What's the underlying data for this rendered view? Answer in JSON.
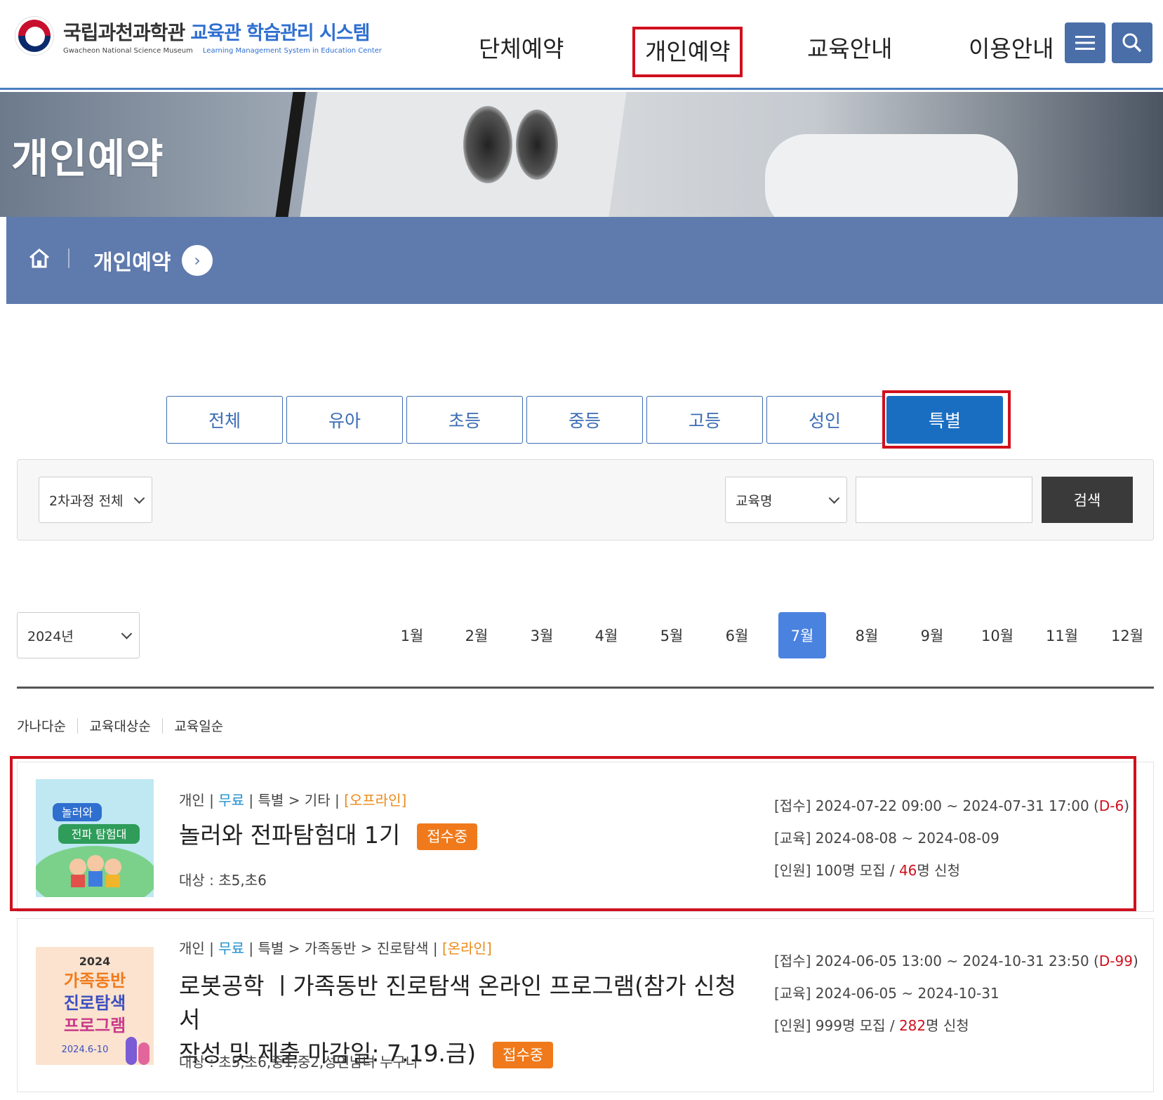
{
  "header": {
    "logo_name": "국립과천과학관",
    "logo_system": "교육관 학습관리 시스템",
    "logo_name_en": "Gwacheon National Science Museum",
    "logo_system_en": "Learning Management System in Education Center",
    "nav": [
      {
        "label": "단체예약"
      },
      {
        "label": "개인예약"
      },
      {
        "label": "교육안내"
      },
      {
        "label": "이용안내"
      }
    ]
  },
  "hero": {
    "title": "개인예약"
  },
  "breadcrumb": {
    "current": "개인예약"
  },
  "tabs": [
    "전체",
    "유아",
    "초등",
    "중등",
    "고등",
    "성인",
    "특별"
  ],
  "active_tab": "특별",
  "filter": {
    "course_select": "2차과정 전체",
    "field_select": "교육명",
    "search_value": "",
    "search_button": "검색"
  },
  "calendar": {
    "year": "2024년",
    "months": [
      "1월",
      "2월",
      "3월",
      "4월",
      "5월",
      "6월",
      "7월",
      "8월",
      "9월",
      "10월",
      "11월",
      "12월"
    ],
    "active_month": "7월"
  },
  "sort": [
    "가나다순",
    "교육대상순",
    "교육일순"
  ],
  "programs": [
    {
      "type": "개인",
      "fee": "무료",
      "category": "특별 > 기타",
      "mode": "[오프라인]",
      "title": "놀러와 전파탐험대 1기",
      "badge": "접수중",
      "target": "대상 : 초5,초6",
      "reception_label": "[접수]",
      "reception": "2024-07-22 09:00 ~ 2024-07-31 17:00",
      "dday": "D-6",
      "education_label": "[교육]",
      "education": "2024-08-08 ~ 2024-08-09",
      "people_label": "[인원]",
      "capacity": "100명 모집 /",
      "applied": "46",
      "applied_suffix": "명 신청",
      "thumb_text": [
        "놀러와",
        "전파 탐험대"
      ]
    },
    {
      "type": "개인",
      "fee": "무료",
      "category": "특별 > 가족동반 > 진로탐색",
      "mode": "[온라인]",
      "title_line1": "로봇공학 ㅣ가족동반 진로탐색 온라인 프로그램(참가 신청서",
      "title_line2": "작성 및 제출 마감일: 7.19.금)",
      "badge": "접수중",
      "target": "대상 : 초5,초6,중1,중2,성인남녀 누구나",
      "reception_label": "[접수]",
      "reception": "2024-06-05 13:00 ~ 2024-10-31 23:50",
      "dday": "D-99",
      "education_label": "[교육]",
      "education": "2024-06-05 ~ 2024-10-31",
      "people_label": "[인원]",
      "capacity": "999명 모집 /",
      "applied": "282",
      "applied_suffix": "명 신청",
      "thumb_text": [
        "2024",
        "가족동반",
        "진로탐색",
        "프로그램",
        "2024.6-10"
      ]
    }
  ]
}
